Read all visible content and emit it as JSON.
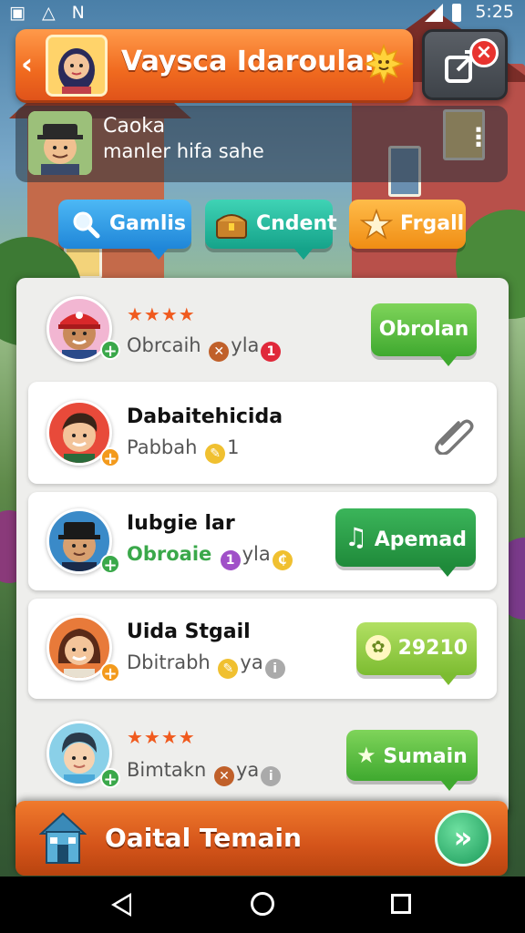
{
  "status_bar": {
    "time": "5:25"
  },
  "header": {
    "back_glyph": "‹",
    "title": "Vaysca Idaroulan",
    "sun_icon": "sun-face-icon",
    "edit_icon": "edit-share-icon",
    "close_glyph": "×"
  },
  "chat_bar": {
    "name": "Caoka",
    "subtitle": "manler hifa sahe",
    "menu_glyph": "⋮"
  },
  "tabs": [
    {
      "label": "Gamlis",
      "icon": "search-icon",
      "color": "#1f86d8"
    },
    {
      "label": "Cndent",
      "icon": "treasure-chest-icon",
      "color": "#15a38a"
    },
    {
      "label": "Frgall",
      "icon": "star-icon",
      "color": "#f08d14"
    }
  ],
  "players": [
    {
      "stars": "★★★★",
      "name": "",
      "sub_text": "Obrcaih",
      "sub_extra": "yla",
      "badge": "1",
      "button": "Obrolan"
    },
    {
      "stars": "",
      "name": "Dabaitehicida",
      "sub_text": "Pabbah",
      "sub_extra": "",
      "badge": "1",
      "button": ""
    },
    {
      "stars": "",
      "name": "Iubgie lar",
      "sub_text": "Obroaie",
      "sub_extra": "yla",
      "badge": "1",
      "button": "Apemad"
    },
    {
      "stars": "",
      "name": "Uida Stgail",
      "sub_text": "Dbitrabh",
      "sub_extra": "ya",
      "badge": "",
      "button": "29210"
    },
    {
      "stars": "★★★★",
      "name": "",
      "sub_text": "Bimtakn",
      "sub_extra": "ya",
      "badge": "",
      "button": "Sumain"
    }
  ],
  "footer": {
    "title": "Oaital Temain",
    "go_glyph": "»"
  },
  "colors": {
    "accent_orange": "#f06a1f",
    "green": "#3fa92f",
    "star": "#f05a1e"
  }
}
